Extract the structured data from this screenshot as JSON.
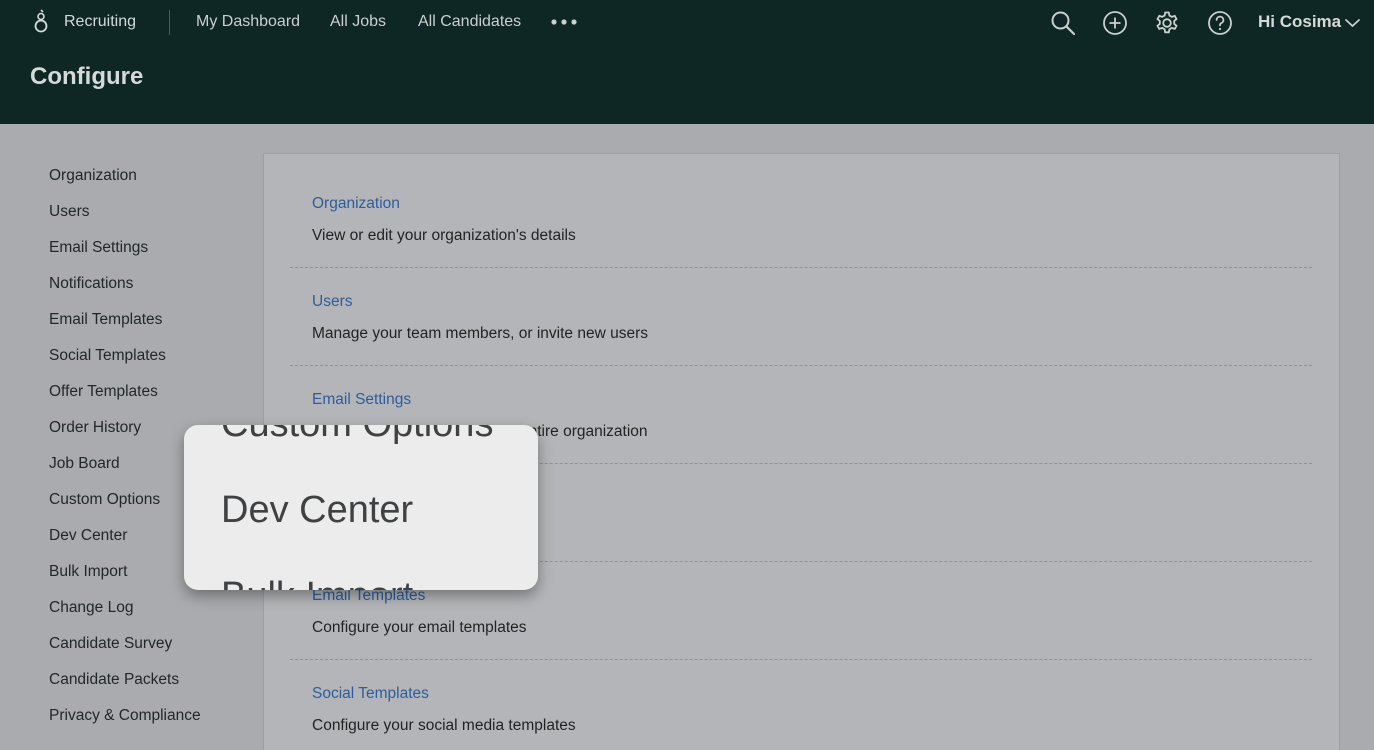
{
  "colors": {
    "topbar_bg": "#0f2724",
    "link_blue": "#2d5d9e",
    "page_bg": "#a9abae"
  },
  "nav": {
    "logo_icon": "greenhouse-sprout-icon",
    "brand": "Recruiting",
    "links": [
      "My Dashboard",
      "All Jobs",
      "All Candidates"
    ],
    "more_icon": "more-horizontal-icon",
    "icons": [
      "search-icon",
      "add-circle-icon",
      "gear-icon",
      "help-circle-icon"
    ],
    "greeting": "Hi Cosima",
    "greeting_icon": "chevron-down-icon"
  },
  "page": {
    "title": "Configure"
  },
  "sidebar": {
    "items": [
      {
        "label": "Organization"
      },
      {
        "label": "Users"
      },
      {
        "label": "Email Settings"
      },
      {
        "label": "Notifications"
      },
      {
        "label": "Email Templates"
      },
      {
        "label": "Social Templates"
      },
      {
        "label": "Offer Templates"
      },
      {
        "label": "Order History"
      },
      {
        "label": "Job Board"
      },
      {
        "label": "Custom Options"
      },
      {
        "label": "Dev Center"
      },
      {
        "label": "Bulk Import"
      },
      {
        "label": "Change Log"
      },
      {
        "label": "Candidate Survey"
      },
      {
        "label": "Candidate Packets"
      },
      {
        "label": "Privacy & Compliance"
      }
    ]
  },
  "sections": [
    {
      "title": "Organization",
      "desc": "View or edit your organization's details"
    },
    {
      "title": "Users",
      "desc": "Manage your team members, or invite new users"
    },
    {
      "title": "Email Settings",
      "desc": "entire organization"
    },
    {
      "title": "",
      "desc": ""
    },
    {
      "title": "Email Templates",
      "desc": "Configure your email templates"
    },
    {
      "title": "Social Templates",
      "desc": "Configure your social media templates"
    }
  ],
  "magnifier": {
    "prev": "Custom Options",
    "current": "Dev Center",
    "next": "Bulk Import"
  }
}
